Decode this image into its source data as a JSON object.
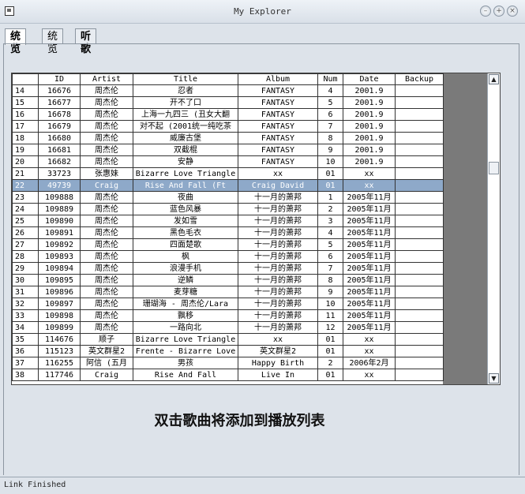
{
  "window": {
    "title": "My Explorer"
  },
  "tabs": [
    {
      "label": "统览",
      "active": true
    },
    {
      "label": "统览",
      "active": false
    },
    {
      "label": "听歌",
      "active": false
    }
  ],
  "table": {
    "columns": [
      "",
      "ID",
      "Artist",
      "Title",
      "Album",
      "Num",
      "Date",
      "Backup"
    ],
    "selected_row": 22,
    "rows": [
      [
        "14",
        "16676",
        "周杰伦",
        "忍者",
        "FANTASY",
        "4",
        "2001.9",
        ""
      ],
      [
        "15",
        "16677",
        "周杰伦",
        "开不了口",
        "FANTASY",
        "5",
        "2001.9",
        ""
      ],
      [
        "16",
        "16678",
        "周杰伦",
        "上海一九四三 (丑女大翻",
        "FANTASY",
        "6",
        "2001.9",
        ""
      ],
      [
        "17",
        "16679",
        "周杰伦",
        "对不起 (2001统一纯吃茶",
        "FANTASY",
        "7",
        "2001.9",
        ""
      ],
      [
        "18",
        "16680",
        "周杰伦",
        "威廉古堡",
        "FANTASY",
        "8",
        "2001.9",
        ""
      ],
      [
        "19",
        "16681",
        "周杰伦",
        "双截棍",
        "FANTASY",
        "9",
        "2001.9",
        ""
      ],
      [
        "20",
        "16682",
        "周杰伦",
        "安静",
        "FANTASY",
        "10",
        "2001.9",
        ""
      ],
      [
        "21",
        "33723",
        "张惠妹",
        "Bizarre Love Triangle",
        "xx",
        "01",
        "xx",
        ""
      ],
      [
        "22",
        "49739",
        "Craig",
        "Rise And Fall (Ft",
        "Craig David",
        "01",
        "xx",
        ""
      ],
      [
        "23",
        "109888",
        "周杰伦",
        "夜曲",
        "十一月的萧邦",
        "1",
        "2005年11月",
        ""
      ],
      [
        "24",
        "109889",
        "周杰伦",
        "蓝色风暴",
        "十一月的萧邦",
        "2",
        "2005年11月",
        ""
      ],
      [
        "25",
        "109890",
        "周杰伦",
        "发如雪",
        "十一月的萧邦",
        "3",
        "2005年11月",
        ""
      ],
      [
        "26",
        "109891",
        "周杰伦",
        "黑色毛衣",
        "十一月的萧邦",
        "4",
        "2005年11月",
        ""
      ],
      [
        "27",
        "109892",
        "周杰伦",
        "四面楚歌",
        "十一月的萧邦",
        "5",
        "2005年11月",
        ""
      ],
      [
        "28",
        "109893",
        "周杰伦",
        "枫",
        "十一月的萧邦",
        "6",
        "2005年11月",
        ""
      ],
      [
        "29",
        "109894",
        "周杰伦",
        "浪漫手机",
        "十一月的萧邦",
        "7",
        "2005年11月",
        ""
      ],
      [
        "30",
        "109895",
        "周杰伦",
        "逆鳞",
        "十一月的萧邦",
        "8",
        "2005年11月",
        ""
      ],
      [
        "31",
        "109896",
        "周杰伦",
        "麦芽糖",
        "十一月的萧邦",
        "9",
        "2005年11月",
        ""
      ],
      [
        "32",
        "109897",
        "周杰伦",
        "珊瑚海 - 周杰伦/Lara",
        "十一月的萧邦",
        "10",
        "2005年11月",
        ""
      ],
      [
        "33",
        "109898",
        "周杰伦",
        "飘移",
        "十一月的萧邦",
        "11",
        "2005年11月",
        ""
      ],
      [
        "34",
        "109899",
        "周杰伦",
        "一路向北",
        "十一月的萧邦",
        "12",
        "2005年11月",
        ""
      ],
      [
        "35",
        "114676",
        "顺子",
        "Bizarre Love Triangle",
        "xx",
        "01",
        "xx",
        ""
      ],
      [
        "36",
        "115123",
        "英文群星2",
        "Frente - Bizarre Love",
        "英文群星2",
        "01",
        "xx",
        ""
      ],
      [
        "37",
        "116255",
        "阿信 (五月",
        "男孩",
        "Happy Birth",
        "2",
        "2006年2月",
        ""
      ],
      [
        "38",
        "117746",
        "Craig",
        "Rise And Fall",
        "Live In",
        "01",
        "xx",
        ""
      ]
    ]
  },
  "hint_text": "双击歌曲将添加到播放列表",
  "status": {
    "text": "Link Finished"
  }
}
